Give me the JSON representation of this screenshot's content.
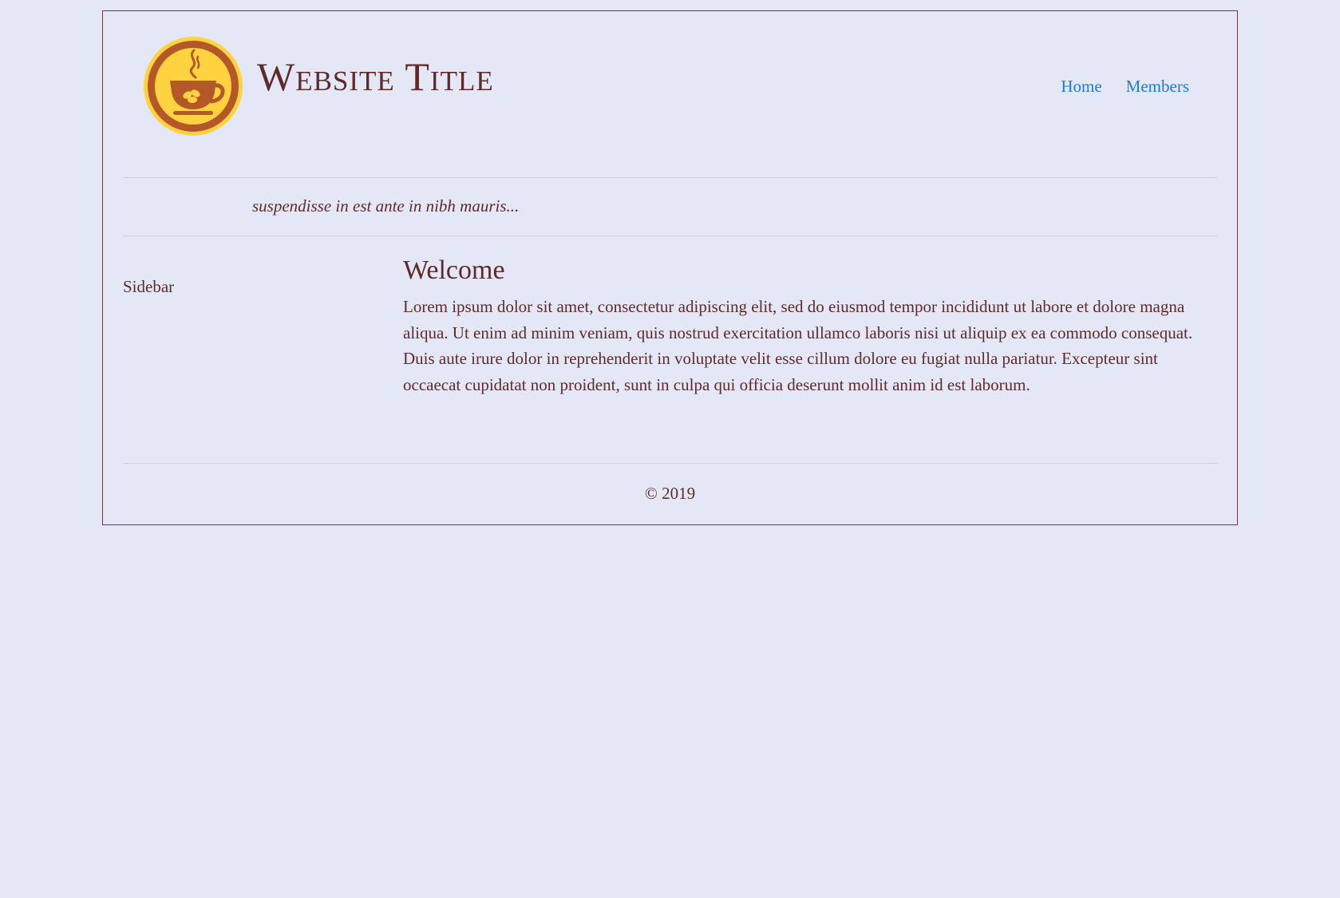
{
  "header": {
    "logo_icon": "coffee-cup-icon",
    "title": "Website Title",
    "nav": [
      {
        "label": "Home"
      },
      {
        "label": "Members"
      }
    ]
  },
  "tagline": "suspendisse in est ante in nibh mauris...",
  "sidebar": {
    "label": "Sidebar"
  },
  "main": {
    "heading": "Welcome",
    "body": "Lorem ipsum dolor sit amet, consectetur adipiscing elit, sed do eiusmod tempor incididunt ut labore et dolore magna aliqua. Ut enim ad minim veniam, quis nostrud exercitation ullamco laboris nisi ut aliquip ex ea commodo consequat. Duis aute irure dolor in reprehenderit in voluptate velit esse cillum dolore eu fugiat nulla pariatur. Excepteur sint occaecat cupidatat non proident, sunt in culpa qui officia deserunt mollit anim id est laborum."
  },
  "footer": {
    "text": "© 2019"
  },
  "colors": {
    "background": "#e4e8f6",
    "text": "#5e2a2a",
    "link": "#1a7be0",
    "border": "#6e3a3f",
    "logo_yellow": "#ffd23f",
    "logo_brown": "#b4582a"
  }
}
